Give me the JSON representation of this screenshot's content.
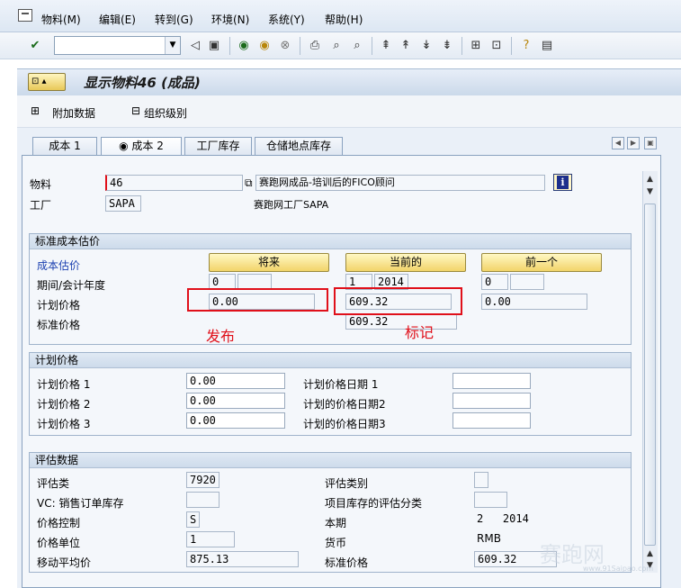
{
  "menu": {
    "items": [
      "物料(M)",
      "编辑(E)",
      "转到(G)",
      "环境(N)",
      "系统(Y)",
      "帮助(H)"
    ]
  },
  "toolbar": {
    "command_value": "",
    "icons": [
      "enter-icon",
      "back-icon",
      "exit-icon",
      "cancel-icon",
      "print-icon",
      "find-icon",
      "find-next-icon",
      "first-page-icon",
      "prev-page-icon",
      "next-page-icon",
      "last-page-icon",
      "new-session-icon",
      "shortcut-icon",
      "help-icon",
      "layout-icon",
      "save-icon",
      "collapse-icon"
    ]
  },
  "title": {
    "text": "显示物料46 (成品)"
  },
  "app_toolbar": {
    "additional_data": "附加数据",
    "org_levels": "组织级别"
  },
  "tabs": [
    {
      "label": "成本 1",
      "active": false
    },
    {
      "label": "成本 2",
      "active": true
    },
    {
      "label": "工厂库存",
      "active": false
    },
    {
      "label": "仓储地点库存",
      "active": false
    }
  ],
  "header": {
    "material_label": "物料",
    "material_value": "46",
    "material_desc": "赛跑网成品-培训后的FICO顾问",
    "plant_label": "工厂",
    "plant_value": "SAPA",
    "plant_desc": "赛跑网工厂SAPA"
  },
  "std_cost_estimate": {
    "group_title": "标准成本估价",
    "row_label_estimate": "成本估价",
    "row_label_period": "期间/会计年度",
    "row_label_planned": "计划价格",
    "row_label_standard": "标准价格",
    "col_future": "将来",
    "col_current": "当前的",
    "col_previous": "前一个",
    "future_period": "0",
    "future_year": "",
    "future_planned": "0.00",
    "current_period": "1",
    "current_year": "2014",
    "current_planned": "609.32",
    "current_standard": "609.32",
    "previous_period": "0",
    "previous_year": "",
    "previous_planned": "0.00",
    "annotation_release": "发布",
    "annotation_mark": "标记"
  },
  "planned_prices": {
    "group_title": "计划价格",
    "price1_label": "计划价格 1",
    "price1_value": "0.00",
    "price2_label": "计划价格 2",
    "price2_value": "0.00",
    "price3_label": "计划价格 3",
    "price3_value": "0.00",
    "date1_label": "计划价格日期 1",
    "date1_value": "",
    "date2_label": "计划的价格日期2",
    "date2_value": "",
    "date3_label": "计划的价格日期3",
    "date3_value": ""
  },
  "valuation": {
    "group_title": "评估数据",
    "class_label": "评估类",
    "class_value": "7920",
    "vc_label": "VC: 销售订单库存",
    "vc_value": "",
    "price_control_label": "价格控制",
    "price_control_value": "S",
    "price_unit_label": "价格单位",
    "price_unit_value": "1",
    "mavg_label": "移动平均价",
    "mavg_value": "875.13",
    "val_category_label": "评估类别",
    "val_category_value": "",
    "proj_stock_label": "项目库存的评估分类",
    "proj_stock_value": "",
    "period_label": "本期",
    "period_value": "2   2014",
    "currency_label": "货币",
    "currency_value": "RMB",
    "std_price_label": "标准价格",
    "std_price_value": "609.32"
  },
  "watermark": {
    "text": "赛跑网",
    "small": "www.91Saipao.com"
  }
}
